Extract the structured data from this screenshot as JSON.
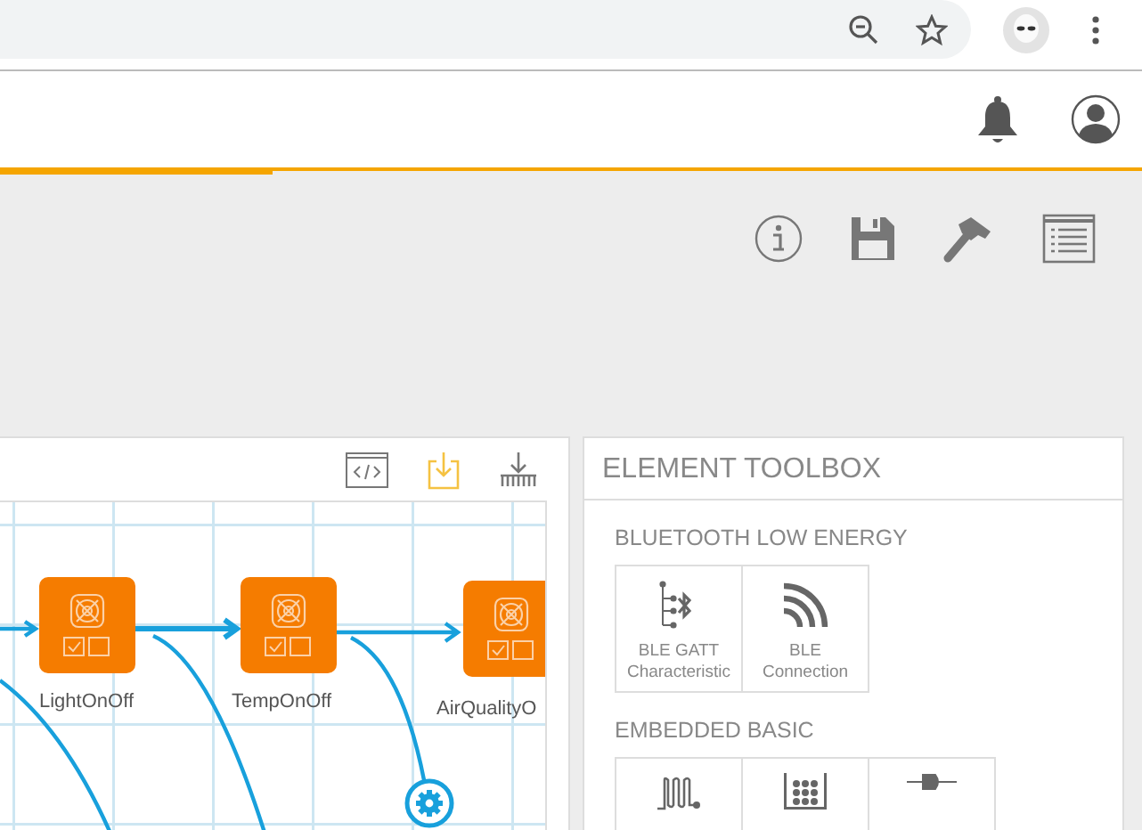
{
  "canvas": {
    "nodes": [
      {
        "label": "LightOnOff",
        "kind": "device"
      },
      {
        "label": "TempOnOff",
        "kind": "device"
      },
      {
        "label": "AirQualityO",
        "kind": "device"
      }
    ]
  },
  "toolbox": {
    "title": "ELEMENT TOOLBOX",
    "sections": [
      {
        "title": "BLUETOOTH LOW ENERGY",
        "items": [
          {
            "kind": "gatt",
            "label": "BLE GATT Characteristic"
          },
          {
            "kind": "signal",
            "label": "BLE Connection"
          }
        ]
      },
      {
        "title": "EMBEDDED BASIC",
        "items": [
          {
            "kind": "pulse"
          },
          {
            "kind": "matrix"
          },
          {
            "kind": "connector"
          }
        ]
      }
    ]
  }
}
